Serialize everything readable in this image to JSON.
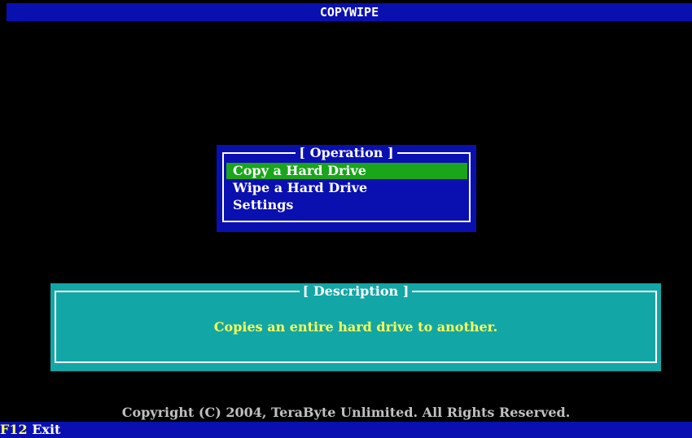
{
  "app": {
    "title": "COPYWIPE"
  },
  "operation_menu": {
    "title": "[ Operation ]",
    "items": [
      {
        "label": "Copy a Hard Drive",
        "selected": true
      },
      {
        "label": "Wipe a Hard Drive",
        "selected": false
      },
      {
        "label": "Settings",
        "selected": false
      }
    ]
  },
  "description": {
    "title": "[ Description ]",
    "text": "Copies an entire hard drive to another."
  },
  "footer": {
    "copyright": "Copyright (C) 2004, TeraByte Unlimited.  All Rights Reserved."
  },
  "status_bar": {
    "key": "F12",
    "label": "Exit"
  },
  "colors": {
    "background": "#000000",
    "menu_background": "#0a10b0",
    "selection": "#1aa51a",
    "description_background": "#13a6a6",
    "description_text": "#ffff55",
    "text": "#ffffff",
    "copyright_text": "#c0c0c0"
  }
}
